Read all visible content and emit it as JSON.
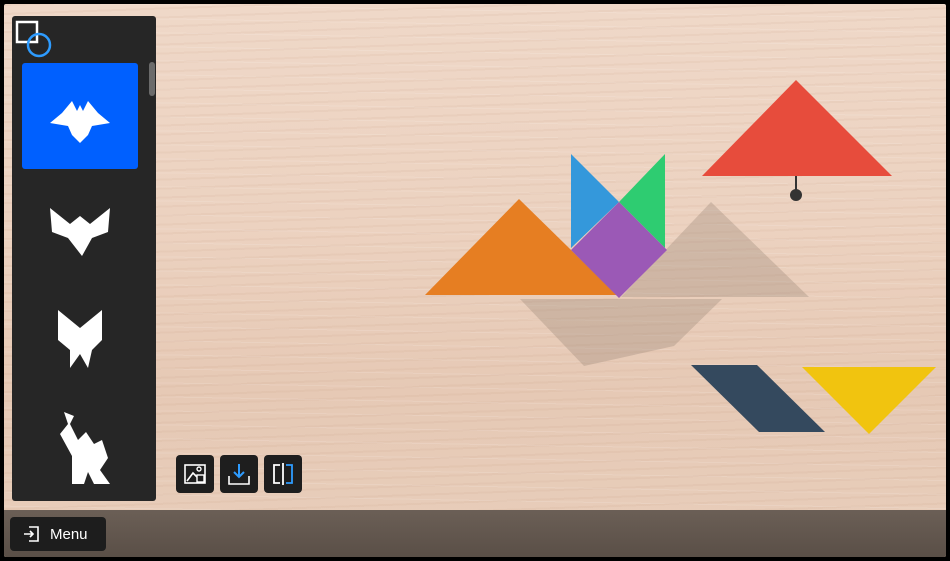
{
  "app": {
    "logo_icon": "tangram-logo-icon"
  },
  "sidebar": {
    "items": [
      {
        "name": "bat-shape",
        "active": true
      },
      {
        "name": "bird-shape",
        "active": false
      },
      {
        "name": "fox-shape",
        "active": false
      },
      {
        "name": "camel-shape",
        "active": false
      }
    ]
  },
  "toolbar": {
    "buttons": [
      {
        "icon": "image-edit-icon"
      },
      {
        "icon": "download-icon"
      },
      {
        "icon": "split-view-icon"
      }
    ]
  },
  "bottom_bar": {
    "menu_label": "Menu",
    "menu_icon": "exit-icon"
  },
  "pieces": {
    "orange_large_triangle": "#e67e22",
    "red_large_triangle": "#e74c3c",
    "blue_small_triangle": "#3498db",
    "green_small_triangle": "#2ecc71",
    "purple_square": "#9b59b6",
    "navy_parallelogram": "#34495e",
    "yellow_medium_triangle": "#f1c40f"
  }
}
